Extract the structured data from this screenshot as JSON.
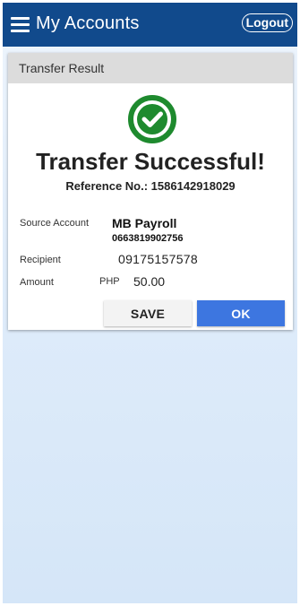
{
  "appbar": {
    "title": "My Accounts",
    "logout_label": "Logout",
    "menu_icon": "hamburger-menu-icon",
    "color": "#114a8c"
  },
  "result_card": {
    "header": "Transfer Result",
    "status_icon": "check-circle-icon",
    "status_icon_color": "#1e8a2e",
    "status_title": "Transfer Successful!",
    "reference": "Reference No.: 1586142918029",
    "source_account_label": "Source Account",
    "source_account_name": "MB Payroll",
    "source_account_number": "0663819902756",
    "recipient_label": "Recipient",
    "recipient_value": "09175157578",
    "amount_label": "Amount",
    "amount_currency": "PHP",
    "amount_value": "50.00"
  },
  "actions": {
    "save_label": "SAVE",
    "ok_label": "OK",
    "ok_color": "#3d76e0"
  }
}
